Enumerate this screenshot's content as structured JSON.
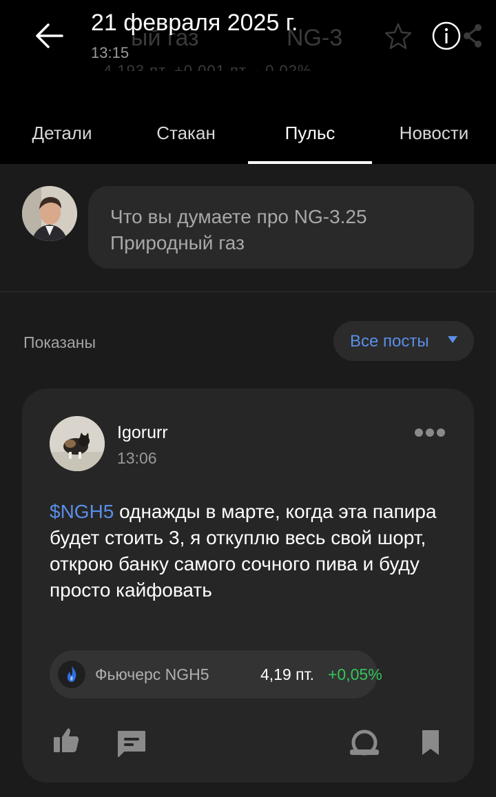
{
  "header": {
    "title": "21 февраля 2025 г.",
    "time": "13:15",
    "ghost_name": "ый газ",
    "ghost_ticker": "NG-3",
    "ghost_sub": "4,193 пт.   +0,001 пт. · 0,02%"
  },
  "tabs": [
    {
      "label": "Детали"
    },
    {
      "label": "Стакан"
    },
    {
      "label": "Пульс"
    },
    {
      "label": "Новости"
    }
  ],
  "compose": {
    "placeholder": "Что вы думаете про NG-3.25 Природный газ"
  },
  "filter": {
    "shown_label": "Показаны",
    "selected": "Все посты"
  },
  "post": {
    "author": "Igorurr",
    "time": "13:06",
    "ticker_tag": "$NGH5",
    "text": " однажды в марте, когда эта папира будет стоить 3, я откуплю весь свой шорт, открою банку самого сочного пива и буду просто кайфовать",
    "instrument": {
      "name": "Фьючерс NGH5",
      "price": "4,19 пт.",
      "change": "+0,05%"
    }
  },
  "colors": {
    "accent": "#5a8fe8",
    "positive": "#33c65a",
    "background": "#1b1b1b",
    "card": "#262626"
  }
}
